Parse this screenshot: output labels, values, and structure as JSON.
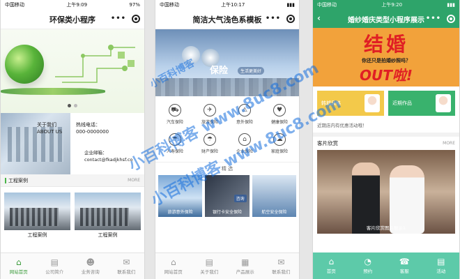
{
  "phone1": {
    "status": {
      "carrier": "中国移动",
      "time": "上午9:09",
      "battery": "97%"
    },
    "title": "环保类小程序",
    "about": {
      "line1": "关于我们",
      "line2": "ABOUT US"
    },
    "hotline": {
      "label": "热线电话：",
      "value": "000-0000000"
    },
    "mail": {
      "label": "企业邮箱：",
      "value": "contact@fkadjkhsf.co"
    },
    "section": {
      "title": "工程案例",
      "more": "MORE"
    },
    "cases": [
      {
        "label": "工程案例"
      },
      {
        "label": "工程案例"
      }
    ],
    "tabs": [
      {
        "label": "网站首页",
        "icon": "home-icon",
        "glyph": "⌂"
      },
      {
        "label": "公司简介",
        "icon": "document-icon",
        "glyph": "▤"
      },
      {
        "label": "业务咨询",
        "icon": "user-icon",
        "glyph": "☻"
      },
      {
        "label": "联系我们",
        "icon": "chat-icon",
        "glyph": "✉"
      }
    ]
  },
  "phone2": {
    "status": {
      "carrier": "中国移动",
      "time": "上午10:17"
    },
    "title": "简洁大气浅色系模板",
    "slogan": "保险",
    "slogan_sub": "生活更美好",
    "grid": [
      {
        "label": "汽车保险",
        "glyph": "⛟"
      },
      {
        "label": "旅游保险",
        "glyph": "✈"
      },
      {
        "label": "意外保险",
        "glyph": "⚠"
      },
      {
        "label": "健康保险",
        "glyph": "♥"
      },
      {
        "label": "人寿保险",
        "glyph": "☂"
      },
      {
        "label": "财产保险",
        "glyph": "☂"
      },
      {
        "label": "企业保险",
        "glyph": "⌂"
      },
      {
        "label": "家庭保险",
        "glyph": "☁"
      }
    ],
    "section_tag": "精 选",
    "cards": [
      {
        "label": "旅游意外保险"
      },
      {
        "label": "银行卡安全保险",
        "chip": "咨询"
      },
      {
        "label": "航空安全保险"
      }
    ],
    "tabs": [
      {
        "label": "网站首页",
        "glyph": "⌂"
      },
      {
        "label": "关于我们",
        "glyph": "▤"
      },
      {
        "label": "产品展示",
        "glyph": "▦"
      },
      {
        "label": "联系我们",
        "glyph": "✉"
      }
    ]
  },
  "phone3": {
    "status": {
      "carrier": "中国移动",
      "time": "上午9:20"
    },
    "title": "婚纱婚庆类型小程序展示",
    "hero": {
      "big": "结婚",
      "sub": "你还只是拍婚纱照吗？",
      "out": "OUT啦!"
    },
    "categories": [
      {
        "label": "韩城风格"
      },
      {
        "label": "近期作品"
      }
    ],
    "notice": "近期店内有优惠活动哦！",
    "section": {
      "title": "客片欣赏",
      "more": "MORE"
    },
    "photo_label": "客片欣赏图片展示1",
    "tabs": [
      {
        "label": "首页",
        "glyph": "⌂"
      },
      {
        "label": "预约",
        "glyph": "◔"
      },
      {
        "label": "客服",
        "glyph": "☎"
      },
      {
        "label": "活动",
        "glyph": "▤"
      }
    ]
  },
  "watermark": {
    "line1": "小百科博客 www.8uc8.com",
    "line2": "小百科博客 www.8uc8.com",
    "line3": "小百科博客"
  }
}
